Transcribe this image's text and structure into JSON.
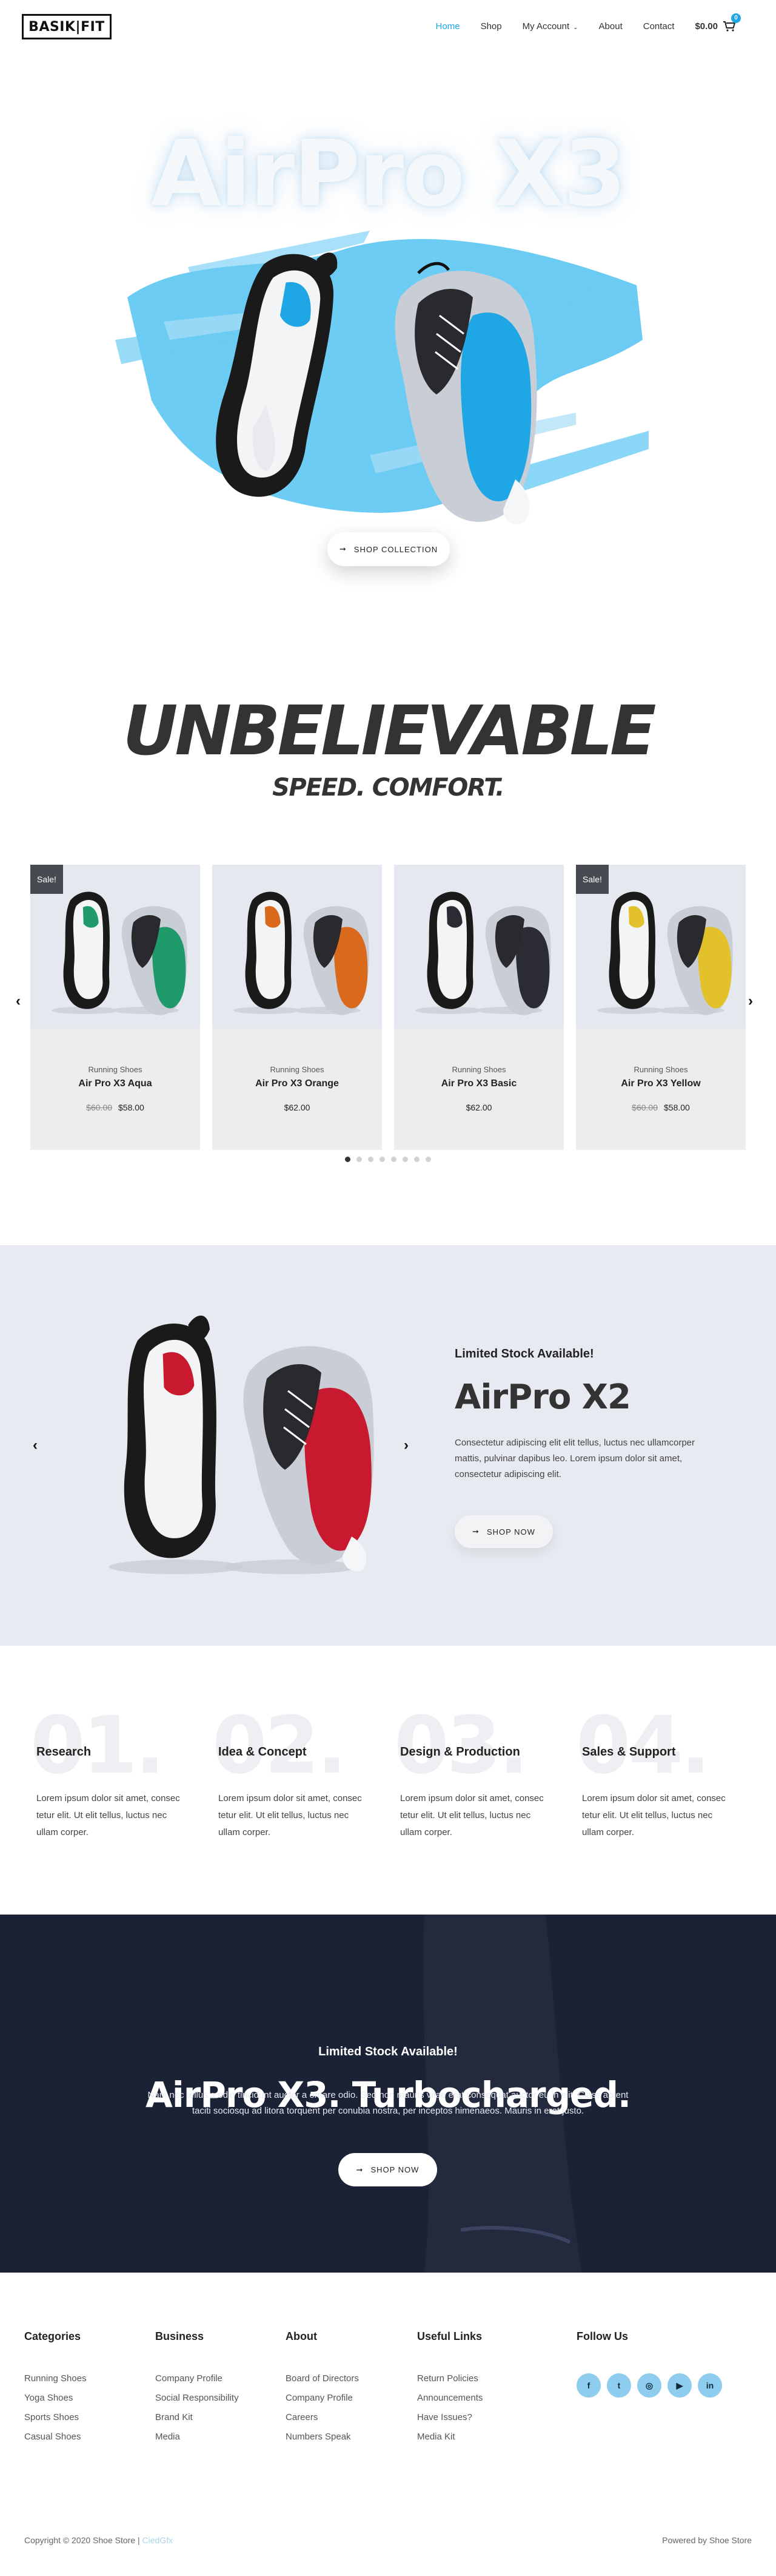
{
  "header": {
    "logo": "BASIK|FIT",
    "nav": [
      {
        "label": "Home",
        "active": true
      },
      {
        "label": "Shop",
        "active": false
      },
      {
        "label": "My Account",
        "active": false,
        "dropdown": true
      },
      {
        "label": "About",
        "active": false
      },
      {
        "label": "Contact",
        "active": false
      }
    ],
    "cart_total": "$0.00",
    "cart_count": "0"
  },
  "hero": {
    "title": "AirPro X3",
    "button": "SHOP COLLECTION"
  },
  "tagline": {
    "headline": "UNBELIEVABLE",
    "subline": "SPEED. COMFORT."
  },
  "products": [
    {
      "sale_badge": "Sale!",
      "category": "Running Shoes",
      "name": "Air Pro X3 Aqua",
      "old_price": "$60.00",
      "price": "$58.00",
      "accent": "#1f9a6b"
    },
    {
      "sale_badge": "",
      "category": "Running Shoes",
      "name": "Air Pro X3 Orange",
      "old_price": "",
      "price": "$62.00",
      "accent": "#d96a1c"
    },
    {
      "sale_badge": "",
      "category": "Running Shoes",
      "name": "Air Pro X3 Basic",
      "old_price": "",
      "price": "$62.00",
      "accent": "#2b2b33"
    },
    {
      "sale_badge": "Sale!",
      "category": "Running Shoes",
      "name": "Air Pro X3 Yellow",
      "old_price": "$60.00",
      "price": "$58.00",
      "accent": "#e3c12a"
    }
  ],
  "carousel": {
    "dot_count": 8,
    "active_dot": 0
  },
  "feature": {
    "label": "Limited Stock Available!",
    "title": "AirPro X2",
    "description": "Consectetur adipiscing elit elit tellus, luctus nec ullamcorper mattis, pulvinar dapibus leo. Lorem ipsum dolor sit amet, consectetur adipiscing elit.",
    "button": "SHOP NOW",
    "accent": "#c8192e"
  },
  "steps": [
    {
      "number": "01.",
      "title": "Research",
      "text": "Lorem ipsum dolor sit amet, consec tetur elit. Ut elit tellus, luctus nec ullam corper."
    },
    {
      "number": "02.",
      "title": "Idea & Concept",
      "text": "Lorem ipsum dolor sit amet, consec tetur elit. Ut elit tellus, luctus nec ullam corper."
    },
    {
      "number": "03.",
      "title": "Design & Production",
      "text": "Lorem ipsum dolor sit amet, consec tetur elit. Ut elit tellus, luctus nec ullam corper."
    },
    {
      "number": "04.",
      "title": "Sales & Support",
      "text": "Lorem ipsum dolor sit amet, consec tetur elit. Ut elit tellus, luctus nec ullam corper."
    }
  ],
  "promo": {
    "label": "Limited Stock Available!",
    "title": "AirPro X3. Turbocharged.",
    "description": "Nam nec tellus a odio tincidunt auctor a ornare odio. Sed non mauris vitae erat consequat auctor eu in elit. Class aptent taciti sociosqu ad litora torquent per conubia nostra, per inceptos himenaeos. Mauris in erat justo.",
    "button": "SHOP NOW"
  },
  "footer": {
    "columns": [
      {
        "title": "Categories",
        "items": [
          "Running Shoes",
          "Yoga Shoes",
          "Sports Shoes",
          "Casual Shoes"
        ]
      },
      {
        "title": "Business",
        "items": [
          "Company Profile",
          "Social Responsibility",
          "Brand Kit",
          "Media"
        ]
      },
      {
        "title": "About",
        "items": [
          "Board of Directors",
          "Company Profile",
          "Careers",
          "Numbers Speak"
        ]
      },
      {
        "title": "Useful Links",
        "items": [
          "Return Policies",
          "Announcements",
          "Have Issues?",
          "Media Kit"
        ]
      }
    ],
    "follow_title": "Follow Us",
    "socials": [
      {
        "icon": "facebook-icon",
        "glyph": "f"
      },
      {
        "icon": "twitter-icon",
        "glyph": "t"
      },
      {
        "icon": "instagram-icon",
        "glyph": "◎"
      },
      {
        "icon": "youtube-icon",
        "glyph": "▶"
      },
      {
        "icon": "linkedin-icon",
        "glyph": "in"
      }
    ],
    "copyright": "Copyright © 2020 Shoe Store |",
    "copyright_link": "CiedGfx",
    "powered": "Powered by Shoe Store"
  },
  "colors": {
    "accent": "#1ea7e4",
    "hero_paint": "#5cc6f2",
    "feature_bg": "#e7eaf0",
    "dark_bg": "#1c2236"
  }
}
